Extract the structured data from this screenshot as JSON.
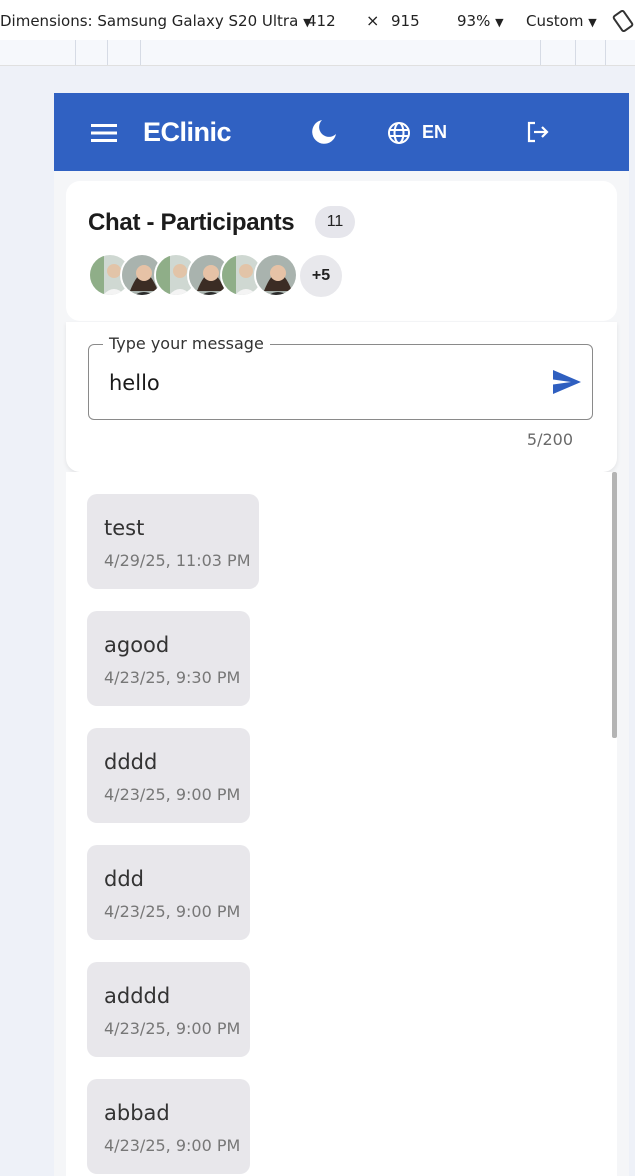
{
  "devtools": {
    "dimensions_label": "Dimensions: Samsung Galaxy S20 Ultra",
    "width": "412",
    "times": "×",
    "height": "915",
    "zoom": "93%",
    "throttle": "Custom"
  },
  "header": {
    "brand": "EClinic",
    "language": "EN",
    "icons": [
      "menu-icon",
      "moon-icon",
      "globe-icon",
      "logout-icon"
    ]
  },
  "chat": {
    "title": "Chat -  Participants",
    "participant_count": "11",
    "more_avatars": "+5"
  },
  "composer": {
    "label": "Type your message",
    "value": "hello",
    "char_counter": "5/200"
  },
  "messages": [
    {
      "text": "test",
      "time": "4/29/25, 11:03 PM"
    },
    {
      "text": "agood",
      "time": "4/23/25, 9:30 PM"
    },
    {
      "text": "dddd",
      "time": "4/23/25, 9:00 PM"
    },
    {
      "text": "ddd",
      "time": "4/23/25, 9:00 PM"
    },
    {
      "text": "adddd",
      "time": "4/23/25, 9:00 PM"
    },
    {
      "text": "abbad",
      "time": "4/23/25, 9:00 PM"
    }
  ],
  "colors": {
    "header_bg": "#3061c2",
    "send_icon": "#2f5fc0",
    "bubble_bg": "#e8e7eb"
  }
}
